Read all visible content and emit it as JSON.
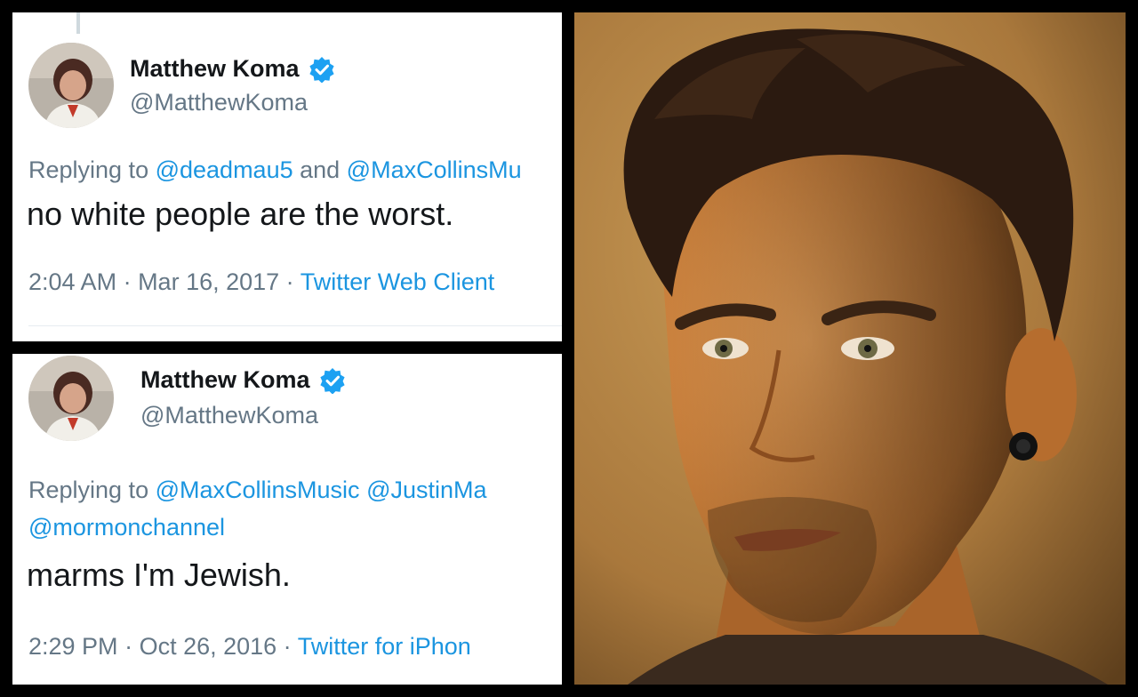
{
  "tweets": [
    {
      "name": "Matthew Koma",
      "handle": "@MatthewKoma",
      "replying_prefix": "Replying to ",
      "mention_1": "@deadmau5",
      "joiner": " and ",
      "mention_2": "@MaxCollinsMu",
      "text": "no white people are the worst.",
      "time": "2:04 AM",
      "sep1": " · ",
      "date": "Mar 16, 2017",
      "sep2": " · ",
      "source": "Twitter Web Client"
    },
    {
      "name": "Matthew Koma",
      "handle": "@MatthewKoma",
      "replying_prefix": "Replying to ",
      "mention_1": "@MaxCollinsMusic",
      "joiner": " ",
      "mention_2": "@JustinMa",
      "mention_3": "@mormonchannel",
      "text": "marms I'm Jewish.",
      "time": "2:29 PM",
      "sep1": " · ",
      "date": "Oct 26, 2016",
      "sep2": " · ",
      "source": "Twitter for iPhon"
    }
  ],
  "colors": {
    "link": "#1b95e0",
    "muted": "#657786",
    "text": "#14171a",
    "verified": "#1da1f2"
  },
  "icons": {
    "verified": "verified-badge-icon"
  }
}
